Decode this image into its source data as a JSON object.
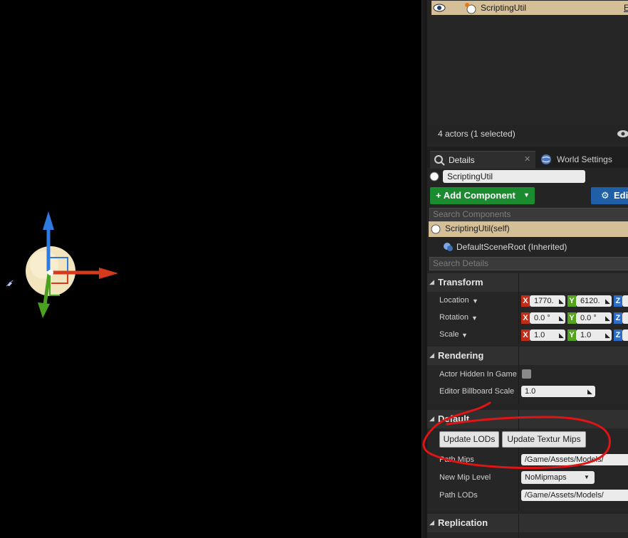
{
  "outliner": {
    "selected_actor": "ScriptingUtil",
    "selected_actor_type": "E",
    "status": "4 actors (1 selected)"
  },
  "tabs": {
    "details": "Details",
    "world_settings": "World Settings"
  },
  "details": {
    "actor_name": "ScriptingUtil",
    "add_component_label": "+ Add Component",
    "edit_label": "Edi",
    "search_components_placeholder": "Search Components",
    "components": [
      {
        "label": "ScriptingUtil(self)"
      },
      {
        "label": "DefaultSceneRoot (Inherited)"
      }
    ],
    "search_details_placeholder": "Search Details"
  },
  "transform": {
    "header": "Transform",
    "location_label": "Location",
    "rotation_label": "Rotation",
    "scale_label": "Scale",
    "location": {
      "x": "1770.",
      "y": "6120.",
      "z": ""
    },
    "rotation": {
      "x": "0.0 °",
      "y": "0.0 °",
      "z": ""
    },
    "scale": {
      "x": "1.0",
      "y": "1.0",
      "z": ""
    },
    "axis_x": "X",
    "axis_y": "Y",
    "axis_z": "Z"
  },
  "rendering": {
    "header": "Rendering",
    "actor_hidden_label": "Actor Hidden In Game",
    "actor_hidden_value": false,
    "billboard_scale_label": "Editor Billboard Scale",
    "billboard_scale_value": "1.0"
  },
  "default": {
    "header": "Default",
    "update_lods_label": "Update LODs",
    "update_mips_label": "Update Textur Mips",
    "path_mips_label": "Path Mips",
    "path_mips_value": "/Game/Assets/Models/",
    "new_mip_level_label": "New Mip Level",
    "new_mip_level_value": "NoMipmaps",
    "path_lods_label": "Path LODs",
    "path_lods_value": "/Game/Assets/Models/"
  },
  "replication": {
    "header": "Replication"
  },
  "colors": {
    "selected_row": "#d5bf97",
    "add_component": "#1b8b2f",
    "edit_button": "#1e5fa8",
    "annotation": "#e01414",
    "gizmo_x": "#d63a1c",
    "gizmo_y": "#4aa11f",
    "gizmo_z": "#2f7ae0"
  },
  "icons": [
    "eye-icon",
    "actor-sphere-icon",
    "details-search-icon",
    "world-icon",
    "component-icon",
    "blueprint-icon",
    "scene-root-icon",
    "expand-arrow-icon",
    "billboard-icon"
  ]
}
